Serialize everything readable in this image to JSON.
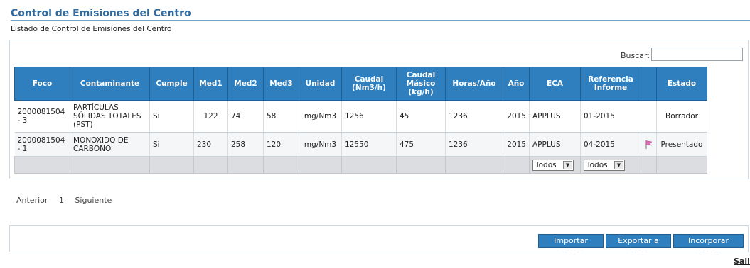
{
  "page": {
    "title": "Control de Emisiones del Centro",
    "subtitle": "Listado de Control de Emisiones del Centro"
  },
  "search": {
    "label": "Buscar:",
    "value": ""
  },
  "table": {
    "columns": [
      "Foco",
      "Contaminante",
      "Cumple",
      "Med1",
      "Med2",
      "Med3",
      "Unidad",
      "Caudal (Nm3/h)",
      "Caudal Másico (kg/h)",
      "Horas/Año",
      "Año",
      "ECA",
      "Referencia Informe",
      "",
      "Estado"
    ],
    "rows": [
      {
        "foco": "2000081504 - 3",
        "contaminante": "PARTÍCULAS SÓLIDAS TOTALES (PST)",
        "cumple": "Si",
        "med1": "122",
        "med2": "74",
        "med3": "58",
        "unidad": "mg/Nm3",
        "caudal": "1256",
        "caudal_masico": "45",
        "horas_ano": "1236",
        "ano": "2015",
        "eca": "APPLUS",
        "referencia": "01-2015",
        "icon": "",
        "estado": "Borrador"
      },
      {
        "foco": "2000081504 - 1",
        "contaminante": "MONOXIDO DE CARBONO",
        "cumple": "Si",
        "med1": "230",
        "med2": "258",
        "med3": "120",
        "unidad": "mg/Nm3",
        "caudal": "12550",
        "caudal_masico": "475",
        "horas_ano": "1236",
        "ano": "2015",
        "eca": "APPLUS",
        "referencia": "04-2015",
        "icon": "flag-icon",
        "estado": "Presentado"
      }
    ],
    "filters": {
      "eca": "Todos",
      "referencia": "Todos"
    }
  },
  "pager": {
    "prev": "Anterior",
    "page": "1",
    "next": "Siguiente"
  },
  "buttons": {
    "importar": "Importar Datos",
    "exportar": "Exportar a Excel",
    "incorporar": "Incorporar Datos",
    "salir": "Salir"
  },
  "colors": {
    "header_bg": "#2f7fbf",
    "title": "#2f6aa0"
  }
}
